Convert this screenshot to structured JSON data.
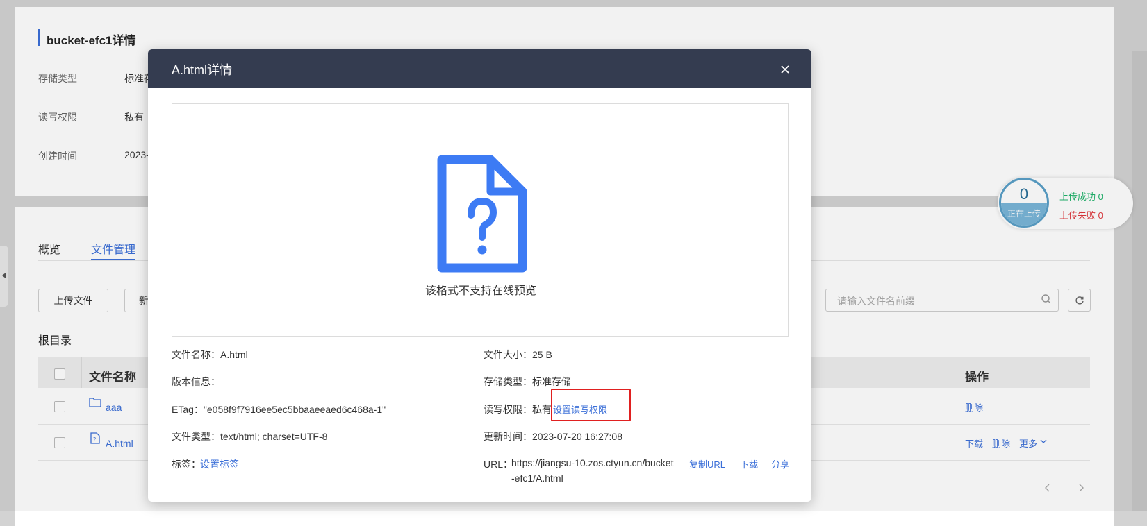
{
  "bucket": {
    "title": "bucket-efc1详情",
    "storage_type_label": "存储类型",
    "storage_type_value": "标准存",
    "permission_label": "读写权限",
    "permission_value": "私有",
    "created_label": "创建时间",
    "created_value": "2023-"
  },
  "tabs": [
    {
      "label": "概览"
    },
    {
      "label": "文件管理",
      "active": true
    }
  ],
  "toolbar": {
    "upload_label": "上传文件",
    "new_label": "新",
    "search_placeholder": "请输入文件名前缀"
  },
  "breadcrumb": "根目录",
  "table": {
    "col_name": "文件名称",
    "col_actions": "操作",
    "rows": [
      {
        "name": "aaa",
        "type": "folder",
        "actions": [
          "删除"
        ]
      },
      {
        "name": "A.html",
        "type": "file",
        "actions": [
          "下载",
          "删除",
          "更多"
        ]
      }
    ]
  },
  "upload_status": {
    "count": "0",
    "label": "正在上传",
    "success": "上传成功 0",
    "fail": "上传失败 0"
  },
  "modal": {
    "title": "A.html详情",
    "preview_text": "该格式不支持在线预览",
    "left": {
      "filename": "文件名称：A.html",
      "version": "版本信息：",
      "etag": "ETag：\"e058f9f7916ee5ec5bbaaeeaed6c468a-1\"",
      "filetype": "文件类型：text/html; charset=UTF-8",
      "tags_label": "标签：",
      "tags_link": "设置标签"
    },
    "right": {
      "size": "文件大小：25 B",
      "storage": "存储类型：标准存储",
      "perm_label": "读写权限：私有",
      "perm_link": "设置读写权限",
      "updated": "更新时间：2023-07-20 16:27:08",
      "url_label": "URL：",
      "url_line1": "https://jiangsu-10.zos.ctyun.cn/bucket",
      "url_line2": "-efc1/A.html",
      "copy_url": "复制URL",
      "download": "下载",
      "share": "分享"
    }
  },
  "colors": {
    "accent": "#3b6fd8",
    "modal_header": "#343c50",
    "file_icon": "#3d7bf4",
    "success": "#1fb36b",
    "fail": "#e0383e",
    "highlight": "#e02020"
  }
}
